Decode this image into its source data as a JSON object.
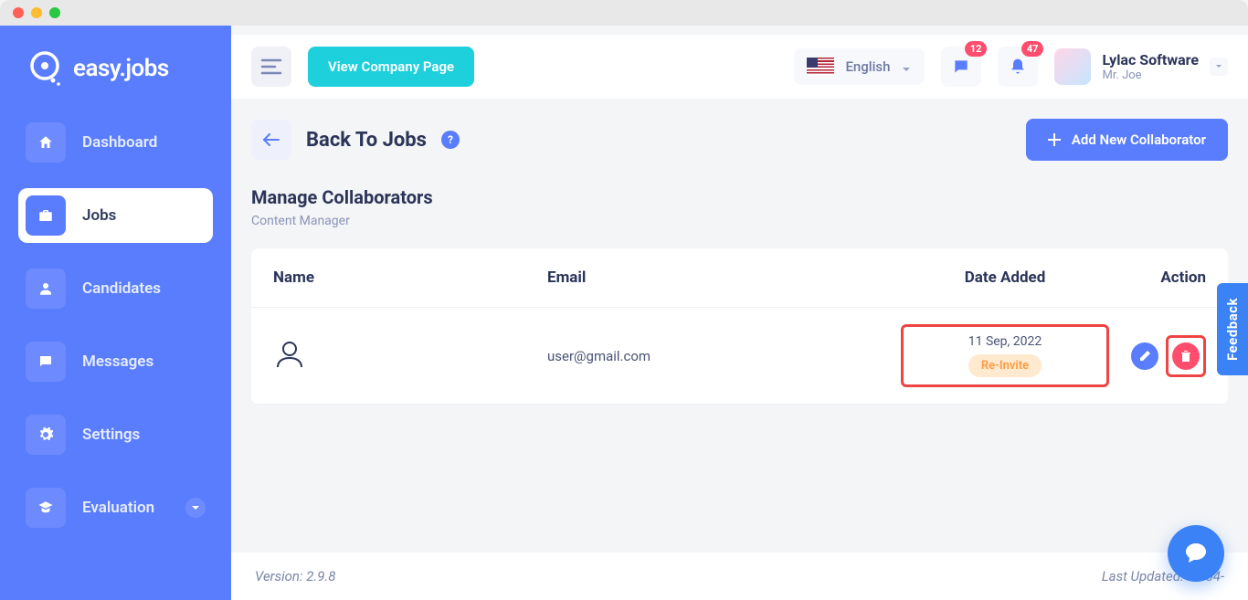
{
  "brand": {
    "name": "easy.jobs"
  },
  "sidebar": {
    "items": [
      {
        "label": "Dashboard"
      },
      {
        "label": "Jobs"
      },
      {
        "label": "Candidates"
      },
      {
        "label": "Messages"
      },
      {
        "label": "Settings"
      },
      {
        "label": "Evaluation"
      }
    ]
  },
  "topbar": {
    "view_company": "View Company Page",
    "language": "English",
    "badges": {
      "messages": "12",
      "notifications": "47"
    },
    "company": "Lylac Software",
    "user": "Mr. Joe"
  },
  "page": {
    "back_label": "Back To Jobs",
    "add_btn": "Add New Collaborator",
    "section_title": "Manage Collaborators",
    "section_sub": "Content Manager"
  },
  "table": {
    "headers": {
      "name": "Name",
      "email": "Email",
      "date": "Date Added",
      "action": "Action"
    },
    "rows": [
      {
        "email": "user@gmail.com",
        "date": "11 Sep, 2022",
        "reinvite": "Re-Invite"
      }
    ]
  },
  "footer": {
    "version_label": "Version: ",
    "version": "2.9.8",
    "updated_label": "Last Updated: ",
    "updated": "09-04-"
  },
  "feedback": "Feedback"
}
